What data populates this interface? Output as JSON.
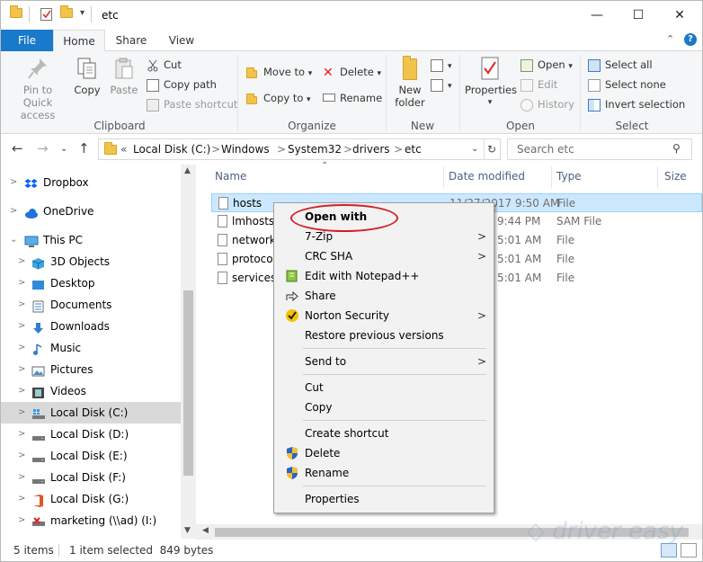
{
  "window": {
    "title": "etc"
  },
  "ribbon_tabs": {
    "file": "File",
    "home": "Home",
    "share": "Share",
    "view": "View"
  },
  "clipboard": {
    "pin": "Pin to Quick access",
    "copy": "Copy",
    "paste": "Paste",
    "cut": "Cut",
    "copy_path": "Copy path",
    "paste_shortcut": "Paste shortcut",
    "group": "Clipboard"
  },
  "organize": {
    "move_to": "Move to",
    "copy_to": "Copy to",
    "delete": "Delete",
    "rename": "Rename",
    "group": "Organize"
  },
  "new_group": {
    "new_folder": "New folder",
    "group": "New"
  },
  "open_group": {
    "properties": "Properties",
    "open": "Open",
    "edit": "Edit",
    "history": "History",
    "group": "Open"
  },
  "select_group": {
    "select_all": "Select all",
    "select_none": "Select none",
    "invert": "Invert selection",
    "group": "Select"
  },
  "address": {
    "prefix": "«",
    "crumbs": [
      "Local Disk (C:)",
      "Windows",
      "System32",
      "drivers",
      "etc"
    ],
    "search_placeholder": "Search etc"
  },
  "nav_pane": {
    "items": [
      {
        "label": "Dropbox",
        "icon": "dropbox-icon"
      },
      {
        "label": "OneDrive",
        "icon": "onedrive-icon"
      },
      {
        "label": "This PC",
        "icon": "this-pc-icon"
      },
      {
        "label": "3D Objects",
        "icon": "3d-objects-icon"
      },
      {
        "label": "Desktop",
        "icon": "desktop-icon"
      },
      {
        "label": "Documents",
        "icon": "documents-icon"
      },
      {
        "label": "Downloads",
        "icon": "downloads-icon"
      },
      {
        "label": "Music",
        "icon": "music-icon"
      },
      {
        "label": "Pictures",
        "icon": "pictures-icon"
      },
      {
        "label": "Videos",
        "icon": "videos-icon"
      },
      {
        "label": "Local Disk (C:)",
        "icon": "drive-icon"
      },
      {
        "label": "Local Disk (D:)",
        "icon": "drive-icon"
      },
      {
        "label": "Local Disk (E:)",
        "icon": "drive-icon"
      },
      {
        "label": "Local Disk (F:)",
        "icon": "drive-icon"
      },
      {
        "label": "Local Disk (G:)",
        "icon": "drive-icon"
      },
      {
        "label": "marketing (\\\\ad) (I:)",
        "icon": "network-drive-icon"
      }
    ]
  },
  "columns": {
    "name": "Name",
    "date": "Date modified",
    "type": "Type",
    "size": "Size"
  },
  "files": [
    {
      "name": "hosts",
      "date": "11/27/2017 9:50 AM",
      "type": "File"
    },
    {
      "name": "lmhosts.",
      "date": "9:44 PM",
      "type": "SAM File"
    },
    {
      "name": "networks",
      "date": "5:01 AM",
      "type": "File"
    },
    {
      "name": "protocol",
      "date": "5:01 AM",
      "type": "File"
    },
    {
      "name": "services",
      "date": "5:01 AM",
      "type": "File"
    }
  ],
  "context_menu": {
    "open_with": "Open with",
    "zip": "7-Zip",
    "crc": "CRC SHA",
    "notepad": "Edit with Notepad++",
    "share": "Share",
    "norton": "Norton Security",
    "restore": "Restore previous versions",
    "send_to": "Send to",
    "cut": "Cut",
    "copy": "Copy",
    "create_shortcut": "Create shortcut",
    "delete": "Delete",
    "rename": "Rename",
    "properties": "Properties"
  },
  "status": {
    "items": "5 items",
    "selected": "1 item selected  849 bytes"
  },
  "colors": {
    "accent": "#1979ca",
    "selection": "#cce8ff",
    "highlight_ring": "#d21f2a"
  }
}
